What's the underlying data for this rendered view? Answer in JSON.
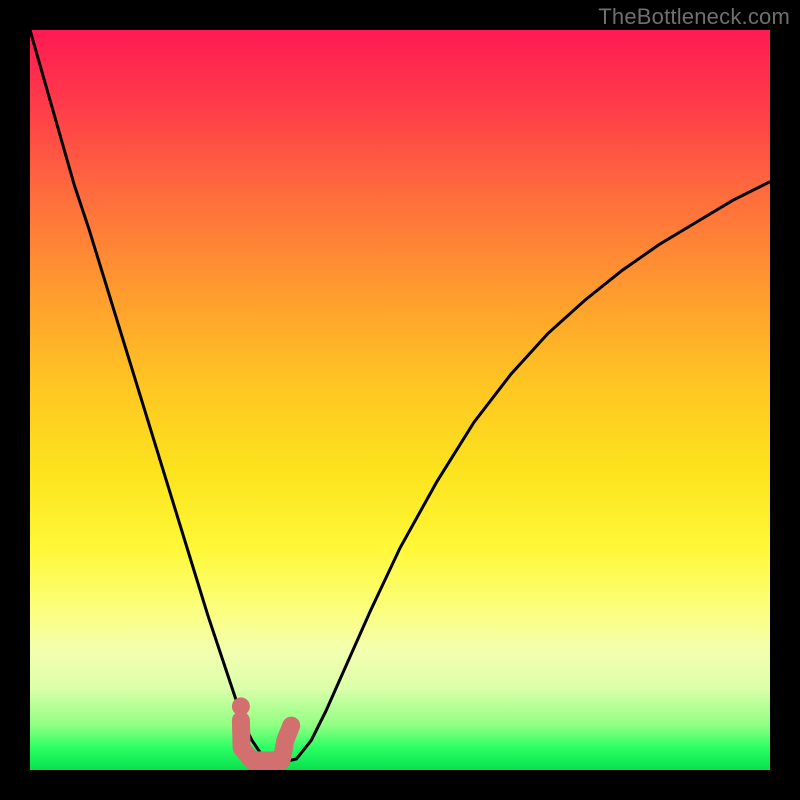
{
  "watermark": "TheBottleneck.com",
  "chart_data": {
    "type": "line",
    "title": "",
    "xlabel": "",
    "ylabel": "",
    "xlim": [
      0,
      100
    ],
    "ylim": [
      0,
      100
    ],
    "grid": false,
    "legend": false,
    "x": [
      0,
      2,
      4,
      6,
      8,
      10,
      12,
      14,
      16,
      18,
      20,
      22,
      24,
      26,
      28,
      29,
      30,
      31,
      32,
      33,
      34,
      36,
      38,
      40,
      42,
      44,
      46,
      50,
      55,
      60,
      65,
      70,
      75,
      80,
      85,
      90,
      95,
      100
    ],
    "values": [
      100,
      93,
      86,
      79,
      73,
      66.5,
      60,
      53.5,
      47,
      40.5,
      34,
      27.5,
      21,
      15,
      9,
      6,
      4,
      2.5,
      1.5,
      1,
      1,
      1.5,
      4,
      8,
      12.5,
      17,
      21.5,
      30,
      39,
      47,
      53.5,
      59,
      63.5,
      67.5,
      71,
      74,
      77,
      79.5
    ],
    "annotations": [
      {
        "type": "marker-path",
        "description": "pink/coral rounded marker segment near curve minimum",
        "points_xy": [
          [
            28.5,
            6.7
          ],
          [
            28.6,
            3.0
          ],
          [
            30.0,
            1.3
          ],
          [
            34.0,
            1.3
          ],
          [
            34.5,
            4.0
          ],
          [
            35.3,
            6.0
          ]
        ]
      }
    ]
  }
}
